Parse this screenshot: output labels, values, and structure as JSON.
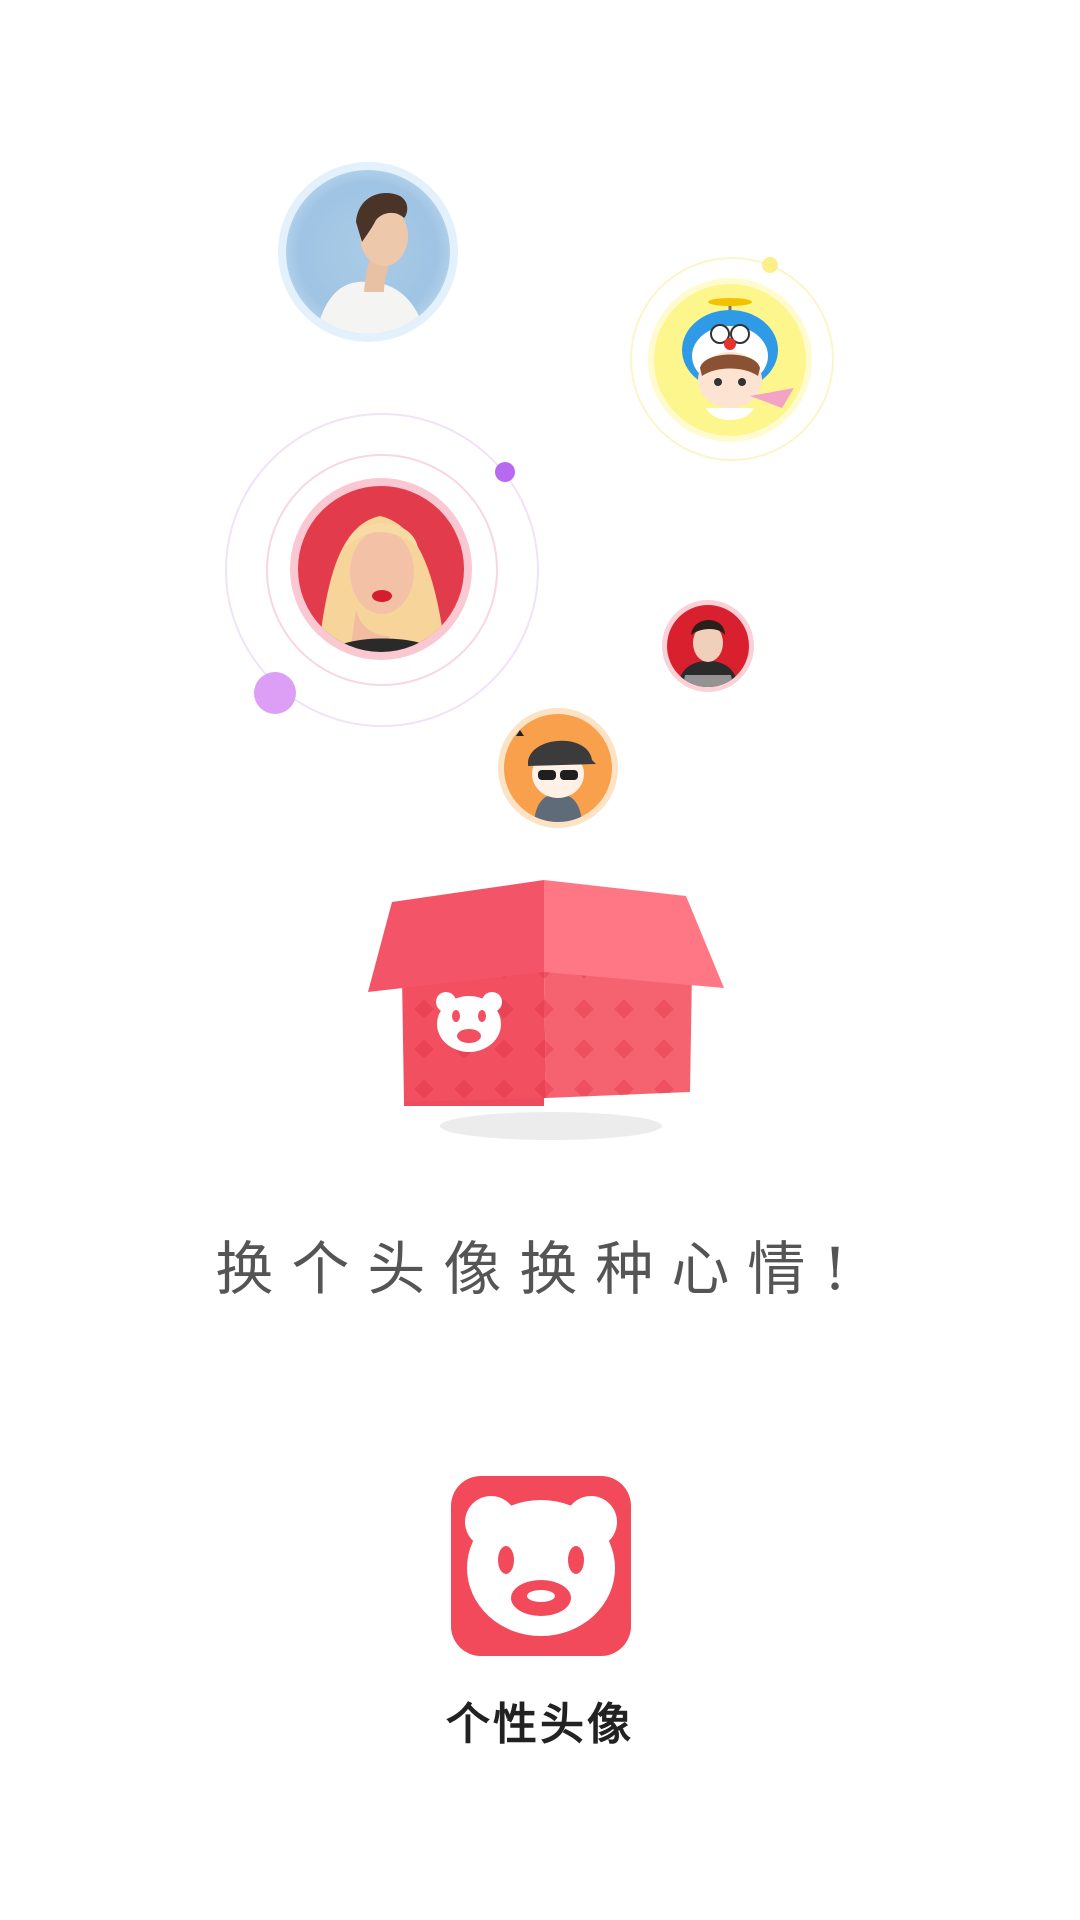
{
  "slogan": "换个头像换种心情!",
  "app": {
    "name": "个性头像"
  },
  "colors": {
    "brand_red": "#f24a5b",
    "box_red": "#f25565",
    "box_light": "#ff7a87",
    "purple_dot": "#b76af0",
    "light_purple_dot": "#dc9ff5",
    "yellow": "#fdf68c"
  },
  "avatars": [
    {
      "name": "avatar-young-man",
      "bg": "#a9cbe6"
    },
    {
      "name": "avatar-doraemon-cartoon",
      "bg": "#fdf68c"
    },
    {
      "name": "avatar-blonde-woman",
      "bg": "#e23b4b"
    },
    {
      "name": "avatar-man-red",
      "bg": "#d9202f"
    },
    {
      "name": "avatar-cartoon-sunglasses",
      "bg": "#f9a04c"
    }
  ],
  "icons": [
    "bear-logo-icon",
    "gift-box-icon"
  ]
}
